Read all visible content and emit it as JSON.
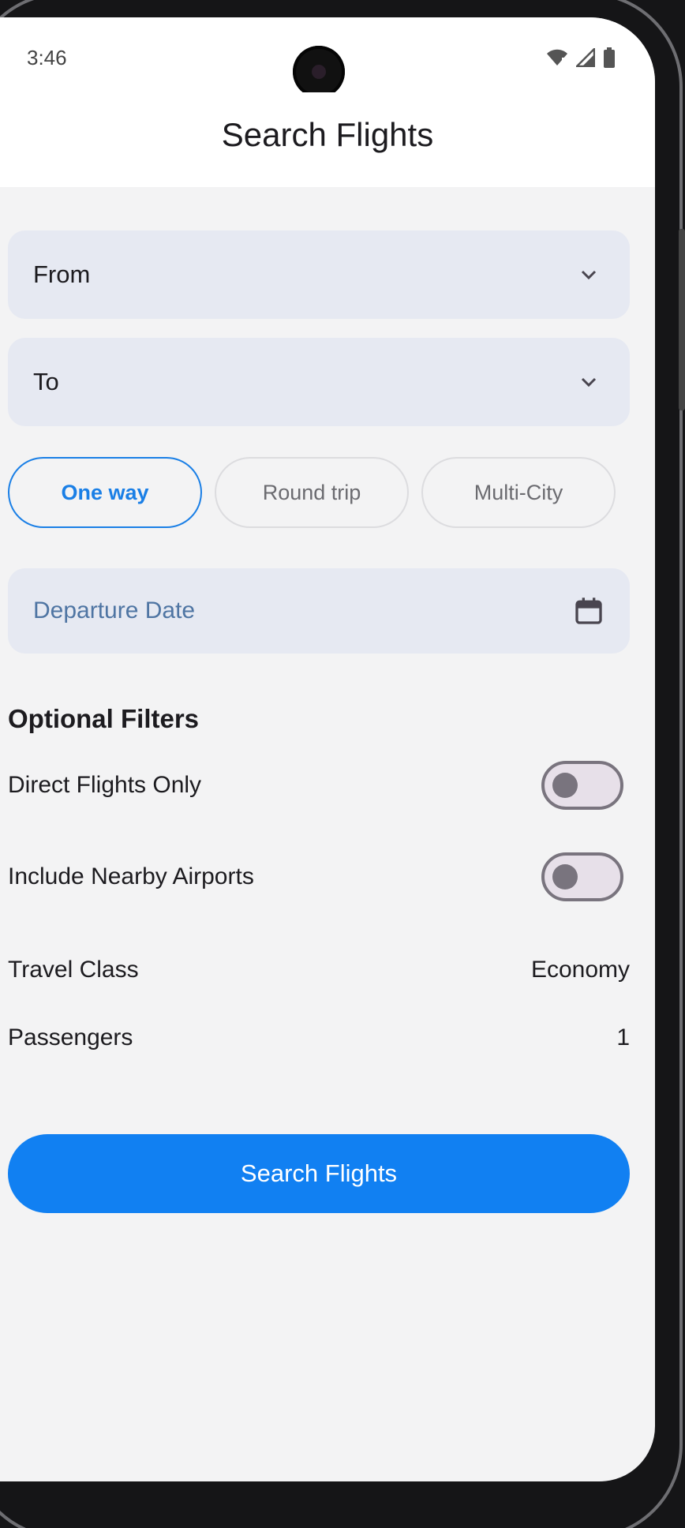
{
  "status_bar": {
    "time": "3:46",
    "icons": [
      "wifi-icon",
      "cellular-signal-icon",
      "battery-icon"
    ]
  },
  "app_bar": {
    "title": "Search Flights"
  },
  "form": {
    "from_label": "From",
    "to_label": "To",
    "trip_types": [
      {
        "label": "One way",
        "selected": true
      },
      {
        "label": "Round trip",
        "selected": false
      },
      {
        "label": "Multi-City",
        "selected": false
      }
    ],
    "departure_date_placeholder": "Departure Date"
  },
  "filters": {
    "section_title": "Optional Filters",
    "direct_flights_label": "Direct Flights Only",
    "direct_flights_on": false,
    "nearby_airports_label": "Include Nearby Airports",
    "nearby_airports_on": false,
    "travel_class_label": "Travel Class",
    "travel_class_value": "Economy",
    "passengers_label": "Passengers",
    "passengers_value": "1"
  },
  "actions": {
    "search_button_label": "Search Flights"
  },
  "colors": {
    "accent": "#1180f2",
    "field_background": "#e6e9f2",
    "background": "#f3f3f4"
  }
}
